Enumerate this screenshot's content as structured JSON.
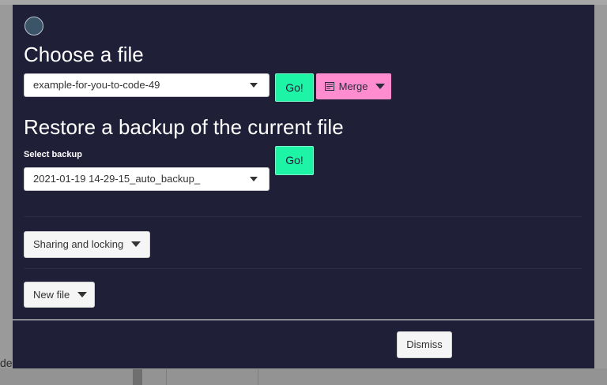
{
  "background": {
    "fragment_text": "de"
  },
  "modal": {
    "choose_title": "Choose a file",
    "file_select_value": "example-for-you-to-code-49",
    "go_label": "Go!",
    "merge_label": "Merge",
    "restore_title": "Restore a backup of the current file",
    "backup_label": "Select backup",
    "backup_select_value": "2021-01-19 14-29-15_auto_backup_",
    "restore_go_label": "Go!",
    "sharing_label": "Sharing and locking",
    "new_file_label": "New file",
    "dismiss_label": "Dismiss"
  },
  "colors": {
    "modal_bg": "#1f1f37",
    "go_button": "#1ef4a6",
    "merge_button": "#ff8ccf"
  },
  "icons": {
    "avatar": "avatar-circle",
    "merge": "flag-icon",
    "dropdown": "caret-down-icon"
  }
}
